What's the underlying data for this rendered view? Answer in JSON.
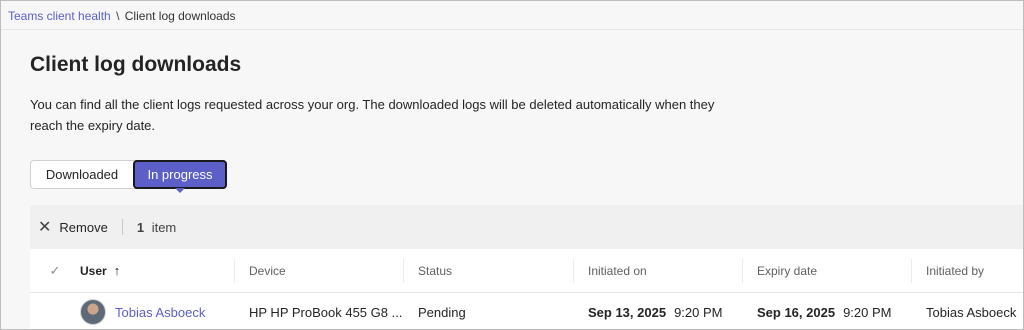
{
  "breadcrumb": {
    "parent": "Teams client health",
    "separator": "\\",
    "current": "Client log downloads"
  },
  "page": {
    "title": "Client log downloads",
    "description": "You can find all the client logs requested across your org. The downloaded logs will be deleted automatically when they reach the expiry date."
  },
  "toggle": {
    "downloaded_label": "Downloaded",
    "in_progress_label": "In progress",
    "selected": "In progress"
  },
  "commandbar": {
    "remove_label": "Remove",
    "item_count": "1",
    "item_word": "item"
  },
  "table": {
    "headers": {
      "check": "✓",
      "user": "User",
      "device": "Device",
      "status": "Status",
      "initiated_on": "Initiated on",
      "expiry_date": "Expiry date",
      "initiated_by": "Initiated by"
    },
    "rows": [
      {
        "user": "Tobias Asboeck",
        "device": "HP HP ProBook 455 G8 ...",
        "status": "Pending",
        "initiated_date": "Sep 13, 2025",
        "initiated_time": "9:20 PM",
        "expiry_date": "Sep 16, 2025",
        "expiry_time": "9:20 PM",
        "initiated_by": "Tobias Asboeck"
      }
    ]
  },
  "colors": {
    "accent": "#5b5fc7",
    "text": "#242424",
    "background": "#f7f7f7"
  }
}
